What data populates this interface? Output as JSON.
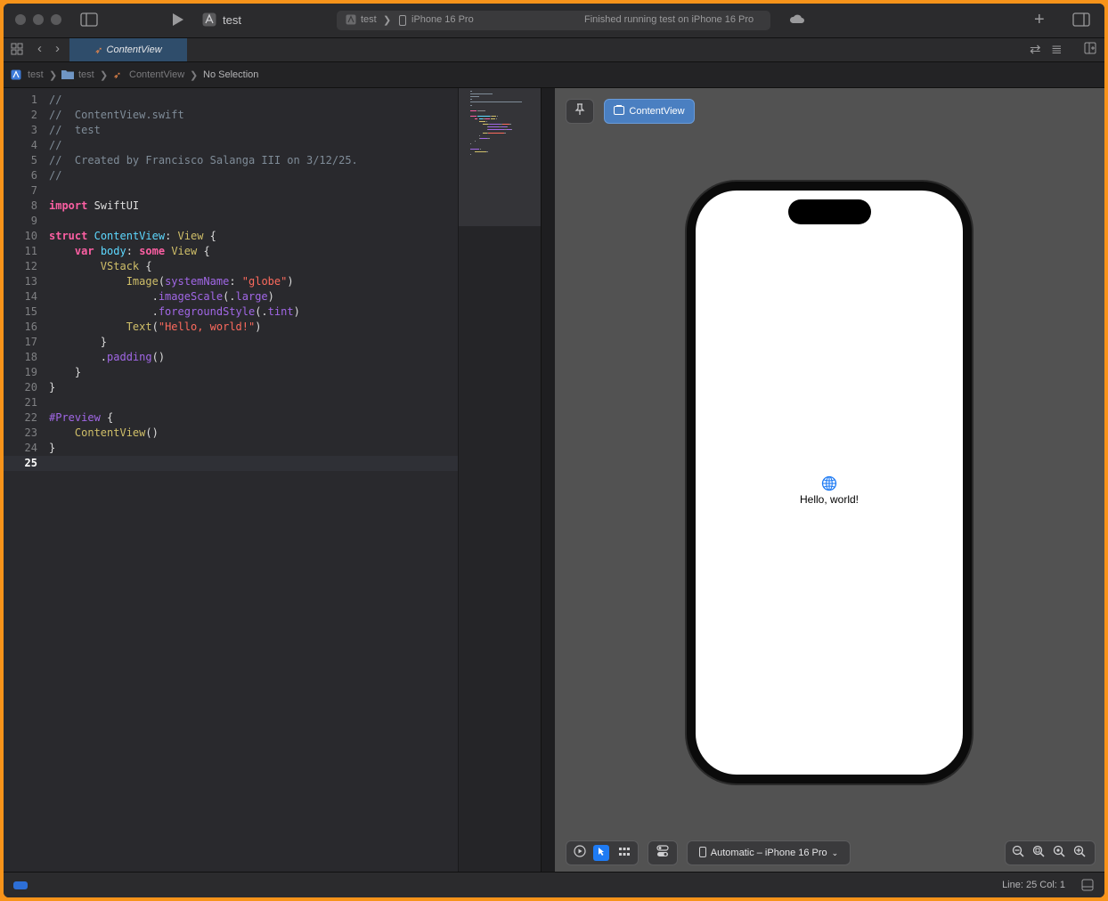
{
  "toolbar": {
    "scheme": "test",
    "status": {
      "project": "test",
      "device": "iPhone 16 Pro",
      "message": "Finished running test on iPhone 16 Pro"
    },
    "icons": [
      "sidebar-icon",
      "play-icon",
      "scheme-app-icon",
      "cloud-icon",
      "plus-icon",
      "inspector-icon"
    ]
  },
  "tabs": {
    "active": "ContentView"
  },
  "breadcrumb": {
    "items": [
      "test",
      "test",
      "ContentView",
      "No Selection"
    ]
  },
  "editor": {
    "current_line": "25",
    "lines": [
      {
        "num": "1",
        "code": [
          {
            "c": "cm",
            "t": "//"
          }
        ]
      },
      {
        "num": "2",
        "code": [
          {
            "c": "cm",
            "t": "//  ContentView.swift"
          }
        ]
      },
      {
        "num": "3",
        "code": [
          {
            "c": "cm",
            "t": "//  test"
          }
        ]
      },
      {
        "num": "4",
        "code": [
          {
            "c": "cm",
            "t": "//"
          }
        ]
      },
      {
        "num": "5",
        "code": [
          {
            "c": "cm",
            "t": "//  Created by Francisco Salanga III on 3/12/25."
          }
        ]
      },
      {
        "num": "6",
        "code": [
          {
            "c": "cm",
            "t": "//"
          }
        ]
      },
      {
        "num": "7",
        "code": []
      },
      {
        "num": "8",
        "code": [
          {
            "c": "k",
            "t": "import"
          },
          {
            "c": "pl",
            "t": " SwiftUI"
          }
        ]
      },
      {
        "num": "9",
        "code": []
      },
      {
        "num": "10",
        "code": [
          {
            "c": "k",
            "t": "struct"
          },
          {
            "c": "pl",
            "t": " "
          },
          {
            "c": "t",
            "t": "ContentView"
          },
          {
            "c": "pl",
            "t": ": "
          },
          {
            "c": "ty",
            "t": "View"
          },
          {
            "c": "pl",
            "t": " {"
          }
        ]
      },
      {
        "num": "11",
        "code": [
          {
            "c": "pl",
            "t": "    "
          },
          {
            "c": "k",
            "t": "var"
          },
          {
            "c": "pl",
            "t": " "
          },
          {
            "c": "t",
            "t": "body"
          },
          {
            "c": "pl",
            "t": ": "
          },
          {
            "c": "k",
            "t": "some"
          },
          {
            "c": "pl",
            "t": " "
          },
          {
            "c": "ty",
            "t": "View"
          },
          {
            "c": "pl",
            "t": " {"
          }
        ]
      },
      {
        "num": "12",
        "code": [
          {
            "c": "pl",
            "t": "        "
          },
          {
            "c": "ty",
            "t": "VStack"
          },
          {
            "c": "pl",
            "t": " {"
          }
        ]
      },
      {
        "num": "13",
        "code": [
          {
            "c": "pl",
            "t": "            "
          },
          {
            "c": "ty",
            "t": "Image"
          },
          {
            "c": "pl",
            "t": "("
          },
          {
            "c": "f",
            "t": "systemName"
          },
          {
            "c": "pl",
            "t": ": "
          },
          {
            "c": "s",
            "t": "\"globe\""
          },
          {
            "c": "pl",
            "t": ")"
          }
        ]
      },
      {
        "num": "14",
        "code": [
          {
            "c": "pl",
            "t": "                ."
          },
          {
            "c": "f",
            "t": "imageScale"
          },
          {
            "c": "pl",
            "t": "(."
          },
          {
            "c": "f",
            "t": "large"
          },
          {
            "c": "pl",
            "t": ")"
          }
        ]
      },
      {
        "num": "15",
        "code": [
          {
            "c": "pl",
            "t": "                ."
          },
          {
            "c": "f",
            "t": "foregroundStyle"
          },
          {
            "c": "pl",
            "t": "(."
          },
          {
            "c": "f",
            "t": "tint"
          },
          {
            "c": "pl",
            "t": ")"
          }
        ]
      },
      {
        "num": "16",
        "code": [
          {
            "c": "pl",
            "t": "            "
          },
          {
            "c": "ty",
            "t": "Text"
          },
          {
            "c": "pl",
            "t": "("
          },
          {
            "c": "s",
            "t": "\"Hello, world!\""
          },
          {
            "c": "pl",
            "t": ")"
          }
        ]
      },
      {
        "num": "17",
        "code": [
          {
            "c": "pl",
            "t": "        }"
          }
        ]
      },
      {
        "num": "18",
        "code": [
          {
            "c": "pl",
            "t": "        ."
          },
          {
            "c": "f",
            "t": "padding"
          },
          {
            "c": "pl",
            "t": "()"
          }
        ]
      },
      {
        "num": "19",
        "code": [
          {
            "c": "pl",
            "t": "    }"
          }
        ]
      },
      {
        "num": "20",
        "code": [
          {
            "c": "pl",
            "t": "}"
          }
        ]
      },
      {
        "num": "21",
        "code": []
      },
      {
        "num": "22",
        "code": [
          {
            "c": "f",
            "t": "#Preview"
          },
          {
            "c": "pl",
            "t": " {"
          }
        ]
      },
      {
        "num": "23",
        "code": [
          {
            "c": "pl",
            "t": "    "
          },
          {
            "c": "ty",
            "t": "ContentView"
          },
          {
            "c": "pl",
            "t": "()"
          }
        ]
      },
      {
        "num": "24",
        "code": [
          {
            "c": "pl",
            "t": "}"
          }
        ]
      },
      {
        "num": "25",
        "code": []
      }
    ]
  },
  "canvas": {
    "pin_icon": "pin-icon",
    "preview_chip": "ContentView",
    "preview_text": "Hello, world!",
    "device_selector": "Automatic – iPhone 16 Pro",
    "mode_icons": [
      "live-mode-icon",
      "selectable-mode-icon",
      "variants-icon",
      "device-settings-icon"
    ],
    "zoom_icons": [
      "zoom-out-icon",
      "zoom-fit-icon",
      "zoom-100-icon",
      "zoom-in-icon"
    ]
  },
  "statusbar": {
    "position": "Line: 25  Col: 1"
  },
  "colors": {
    "frame": "#f7931a",
    "accent": "#4a7fc1",
    "keyword": "#fc5fa3",
    "type": "#d0bf69",
    "string": "#fc6a5d",
    "function": "#a167e6",
    "comment": "#7f8c98"
  }
}
